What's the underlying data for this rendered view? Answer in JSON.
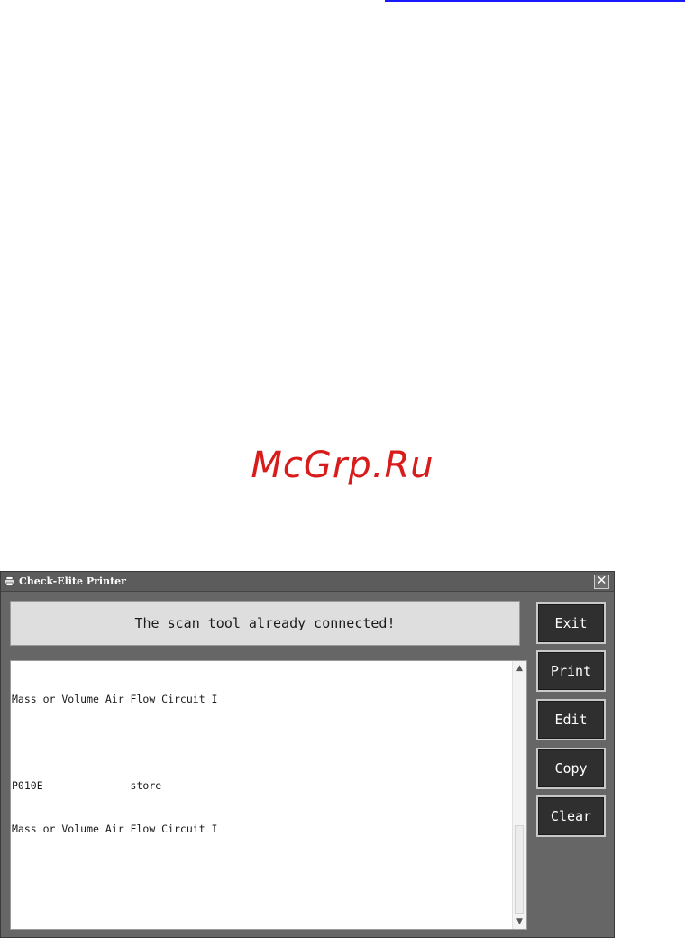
{
  "watermark": {
    "text": "McGrp.Ru"
  },
  "window": {
    "title": "Check-Elite Printer",
    "close_glyph": "✕",
    "status_message": "The scan tool already connected!",
    "log_lines": [
      "Mass or Volume Air Flow Circuit I",
      "",
      "P010E              store",
      "Mass or Volume Air Flow Circuit I"
    ],
    "buttons": {
      "exit": "Exit",
      "print": "Print",
      "edit": "Edit",
      "copy": "Copy",
      "clear": "Clear"
    },
    "icons": {
      "title": "printer-icon",
      "scroll_up": "scroll-up-arrow-icon",
      "scroll_down": "scroll-down-arrow-icon"
    }
  },
  "colors": {
    "watermark": "#d81b1b",
    "window_bg": "#666666",
    "button_bg": "#2f2f2f",
    "status_bg": "#dedede",
    "link_line": "#1a1aff"
  }
}
